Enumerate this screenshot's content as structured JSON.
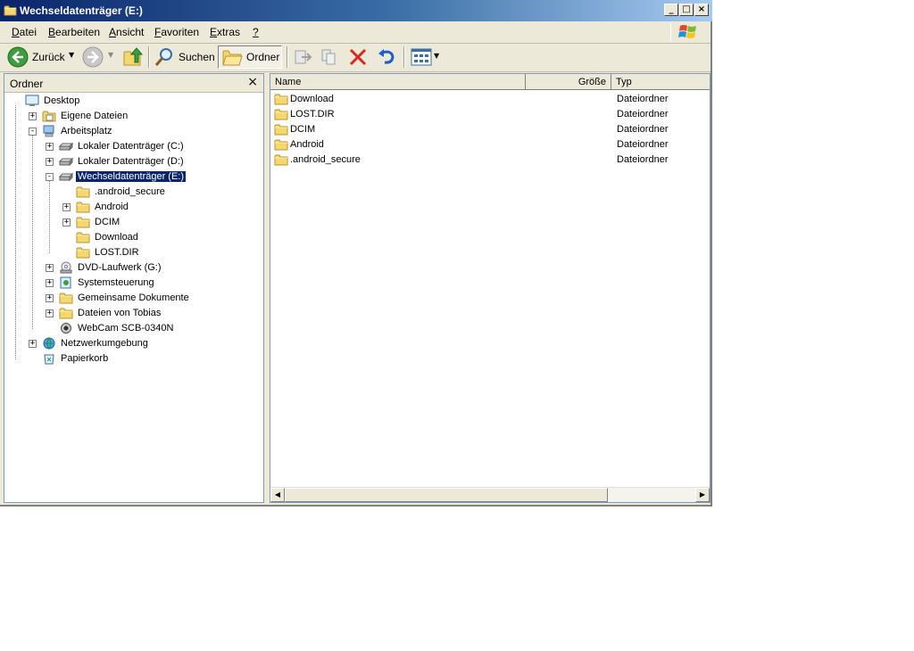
{
  "window": {
    "title": "Wechseldatenträger (E:)",
    "controls": {
      "minimize": "_",
      "maximize": "□",
      "close": "×"
    }
  },
  "menubar": {
    "items": [
      {
        "label": "Datei",
        "accel": "D",
        "rest": "atei"
      },
      {
        "label": "Bearbeiten",
        "accel": "B",
        "rest": "earbeiten"
      },
      {
        "label": "Ansicht",
        "accel": "A",
        "rest": "nsicht"
      },
      {
        "label": "Favoriten",
        "accel": "F",
        "rest": "avoriten"
      },
      {
        "label": "Extras",
        "accel": "E",
        "rest": "xtras"
      },
      {
        "label": "?",
        "accel": "?",
        "rest": ""
      }
    ]
  },
  "toolbar": {
    "back_label": "Zurück",
    "search_label": "Suchen",
    "folders_label": "Ordner"
  },
  "folder_pane": {
    "title": "Ordner",
    "close": "×",
    "nodes": [
      {
        "label": "Desktop",
        "icon": "desktop-icon"
      },
      {
        "label": "Eigene Dateien",
        "icon": "documents-icon",
        "expander": "+"
      },
      {
        "label": "Arbeitsplatz",
        "icon": "computer-icon",
        "expander": "−"
      },
      {
        "label": "Lokaler Datenträger (C:)",
        "icon": "drive-icon",
        "expander": "+"
      },
      {
        "label": "Lokaler Datenträger (D:)",
        "icon": "drive-icon",
        "expander": "+"
      },
      {
        "label": "Wechseldatenträger (E:)",
        "icon": "removable-drive-icon",
        "expander": "−",
        "selected": true
      },
      {
        "label": ".android_secure",
        "icon": "folder-icon"
      },
      {
        "label": "Android",
        "icon": "folder-icon",
        "expander": "+"
      },
      {
        "label": "DCIM",
        "icon": "folder-icon",
        "expander": "+"
      },
      {
        "label": "Download",
        "icon": "folder-icon"
      },
      {
        "label": "LOST.DIR",
        "icon": "folder-icon"
      },
      {
        "label": "DVD-Laufwerk (G:)",
        "icon": "dvd-drive-icon",
        "expander": "+"
      },
      {
        "label": "Systemsteuerung",
        "icon": "control-panel-icon",
        "expander": "+"
      },
      {
        "label": "Gemeinsame Dokumente",
        "icon": "folder-icon",
        "expander": "+"
      },
      {
        "label": "Dateien von Tobias",
        "icon": "folder-icon",
        "expander": "+"
      },
      {
        "label": "WebCam SCB-0340N",
        "icon": "webcam-icon"
      },
      {
        "label": "Netzwerkumgebung",
        "icon": "network-icon",
        "expander": "+"
      },
      {
        "label": "Papierkorb",
        "icon": "recycle-bin-icon"
      }
    ]
  },
  "file_list": {
    "columns": {
      "name": "Name",
      "size": "Größe",
      "type": "Typ"
    },
    "rows": [
      {
        "name": "Download",
        "type": "Dateiordner"
      },
      {
        "name": "LOST.DIR",
        "type": "Dateiordner"
      },
      {
        "name": "DCIM",
        "type": "Dateiordner"
      },
      {
        "name": "Android",
        "type": "Dateiordner"
      },
      {
        "name": ".android_secure",
        "type": "Dateiordner"
      }
    ]
  },
  "colors": {
    "window_bg": "#ece9d8",
    "selection": "#0a246a",
    "folder_yellow": "#f5d76e"
  }
}
